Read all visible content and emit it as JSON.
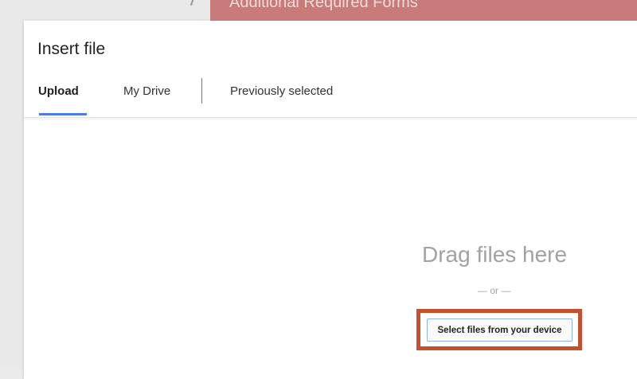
{
  "backdrop": {
    "banner_text": "Additional Required Forms"
  },
  "dialog": {
    "title": "Insert file",
    "tabs": [
      {
        "label": "Upload",
        "active": true
      },
      {
        "label": "My Drive",
        "active": false
      },
      {
        "label": "Previously selected",
        "active": false
      }
    ]
  },
  "upload": {
    "drag_text": "Drag files here",
    "or_text": "— or —",
    "select_button_label": "Select files from your device"
  },
  "colors": {
    "accent": "#4a7de8",
    "highlight": "#c4502d",
    "banner": "#c97a7a"
  }
}
